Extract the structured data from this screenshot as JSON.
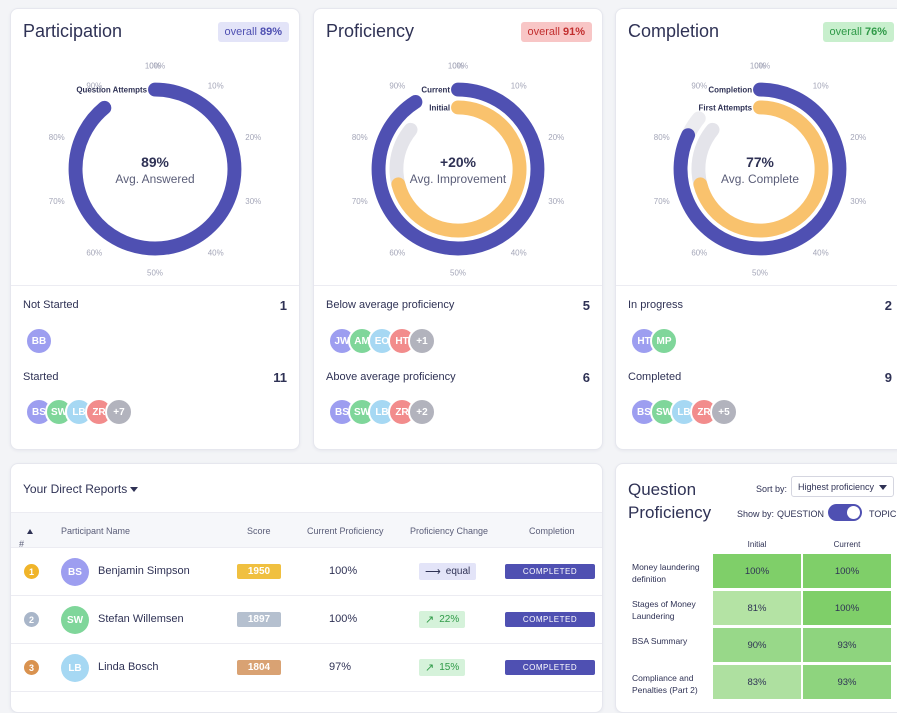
{
  "cards": [
    {
      "title": "Participation",
      "pill_prefix": "overall ",
      "pill_value": "89%",
      "pill_bg": "#e3e4f8",
      "pill_color": "#4f50b2",
      "center_value": "89%",
      "center_label": "Avg. Answered",
      "arc_labels": [
        "Question Attempts"
      ],
      "arcs": [
        {
          "value": 0.89,
          "color": "#4f50b2"
        }
      ],
      "row1_label": "Not Started",
      "row1_count": "1",
      "row1_avatars": [
        {
          "initials": "BB",
          "color": "#9d9ef0"
        }
      ],
      "row2_label": "Started",
      "row2_count": "11",
      "row2_avatars": [
        {
          "initials": "BS",
          "color": "#9d9ef0"
        },
        {
          "initials": "SW",
          "color": "#7fd69a"
        },
        {
          "initials": "LB",
          "color": "#a6d8f3"
        },
        {
          "initials": "ZR",
          "color": "#f28c8c"
        },
        {
          "initials": "+7",
          "color": "#b2b3bd"
        }
      ]
    },
    {
      "title": "Proficiency",
      "pill_prefix": "overall ",
      "pill_value": "91%",
      "pill_bg": "#f8c6c6",
      "pill_color": "#c22f2f",
      "center_value": "+20%",
      "center_label": "Avg. Improvement",
      "arc_labels": [
        "Current",
        "Initial"
      ],
      "arcs": [
        {
          "value": 0.91,
          "color": "#4f50b2"
        },
        {
          "value": 0.71,
          "color": "#f9c26d"
        }
      ],
      "row1_label": "Below average proficiency",
      "row1_count": "5",
      "row1_avatars": [
        {
          "initials": "JW",
          "color": "#9d9ef0"
        },
        {
          "initials": "AM",
          "color": "#7fd69a"
        },
        {
          "initials": "EO",
          "color": "#a6d8f3"
        },
        {
          "initials": "HT",
          "color": "#f28c8c"
        },
        {
          "initials": "+1",
          "color": "#b2b3bd"
        }
      ],
      "row2_label": "Above average proficiency",
      "row2_count": "6",
      "row2_avatars": [
        {
          "initials": "BS",
          "color": "#9d9ef0"
        },
        {
          "initials": "SW",
          "color": "#7fd69a"
        },
        {
          "initials": "LB",
          "color": "#a6d8f3"
        },
        {
          "initials": "ZR",
          "color": "#f28c8c"
        },
        {
          "initials": "+2",
          "color": "#b2b3bd"
        }
      ]
    },
    {
      "title": "Completion",
      "pill_prefix": "overall ",
      "pill_value": "76%",
      "pill_bg": "#c8efcd",
      "pill_color": "#2f9a48",
      "center_value": "77%",
      "center_label": "Avg. Complete",
      "arc_labels": [
        "Completion",
        "First Attempts"
      ],
      "arcs": [
        {
          "value": 0.82,
          "color": "#4f50b2"
        },
        {
          "value": 0.71,
          "color": "#f9c26d"
        }
      ],
      "row1_label": "In progress",
      "row1_count": "2",
      "row1_avatars": [
        {
          "initials": "HT",
          "color": "#9d9ef0"
        },
        {
          "initials": "MP",
          "color": "#7fd69a"
        }
      ],
      "row2_label": "Completed",
      "row2_count": "9",
      "row2_avatars": [
        {
          "initials": "BS",
          "color": "#9d9ef0"
        },
        {
          "initials": "SW",
          "color": "#7fd69a"
        },
        {
          "initials": "LB",
          "color": "#a6d8f3"
        },
        {
          "initials": "ZR",
          "color": "#f28c8c"
        },
        {
          "initials": "+5",
          "color": "#b2b3bd"
        }
      ]
    }
  ],
  "ticks": [
    "0%",
    "10%",
    "20%",
    "30%",
    "40%",
    "50%",
    "60%",
    "70%",
    "80%",
    "90%",
    "100%"
  ],
  "direct_reports": {
    "title": "Your Direct Reports",
    "headers": {
      "rank": "#",
      "name": "Participant Name",
      "score": "Score",
      "proficiency": "Current Proficiency",
      "change": "Proficiency Change",
      "completion": "Completion"
    },
    "rows": [
      {
        "rank": "1",
        "rank_color": "#f0b429",
        "initials": "BS",
        "avatar_color": "#9d9ef0",
        "name": "Benjamin Simpson",
        "score": "1950",
        "score_color": "#f0c040",
        "proficiency": "100%",
        "change_icon": "arrow-right-icon",
        "change": "equal",
        "change_bg": "#e3e4f8",
        "change_color": "#2f3255",
        "status": "COMPLETED"
      },
      {
        "rank": "2",
        "rank_color": "#a9b6c9",
        "initials": "SW",
        "avatar_color": "#7fd69a",
        "name": "Stefan Willemsen",
        "score": "1897",
        "score_color": "#b5c0cf",
        "proficiency": "100%",
        "change_icon": "trend-up-icon",
        "change": "22%",
        "change_bg": "#d5f2da",
        "change_color": "#2f9a48",
        "status": "COMPLETED"
      },
      {
        "rank": "3",
        "rank_color": "#d9924f",
        "initials": "LB",
        "avatar_color": "#a6d8f3",
        "name": "Linda Bosch",
        "score": "1804",
        "score_color": "#d9a273",
        "proficiency": "97%",
        "change_icon": "trend-up-icon",
        "change": "15%",
        "change_bg": "#d5f2da",
        "change_color": "#2f9a48",
        "status": "COMPLETED"
      }
    ]
  },
  "question_proficiency": {
    "title": "Question Proficiency",
    "sort_label": "Sort by:",
    "sort_value": "Highest proficiency",
    "show_label": "Show by:",
    "option1": "QUESTION",
    "option2": "TOPIC",
    "col_initial": "Initial",
    "col_current": "Current",
    "rows": [
      {
        "name": "Money laundering definition",
        "initial": "100%",
        "initial_color": "#7fcf69",
        "current": "100%",
        "current_color": "#7fcf69"
      },
      {
        "name": "Stages of Money Laundering",
        "initial": "81%",
        "initial_color": "#b4e3a4",
        "current": "100%",
        "current_color": "#7fcf69"
      },
      {
        "name": "BSA Summary",
        "initial": "90%",
        "initial_color": "#98d889",
        "current": "93%",
        "current_color": "#8ed47e"
      },
      {
        "name": "Compliance and Penalties (Part 2)",
        "initial": "83%",
        "initial_color": "#aee0a0",
        "current": "93%",
        "current_color": "#8ed47e"
      }
    ]
  }
}
